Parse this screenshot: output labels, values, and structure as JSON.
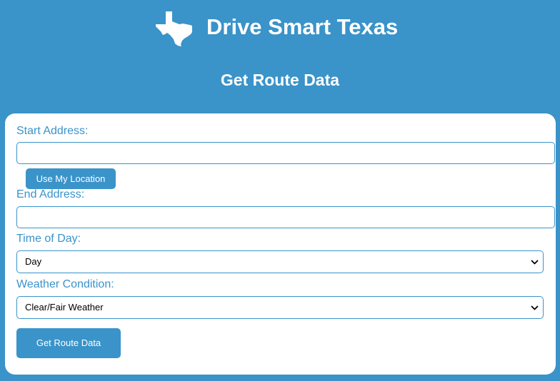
{
  "header": {
    "logo_icon": "texas-state-icon",
    "brand": "Drive Smart Texas",
    "subtitle": "Get Route Data"
  },
  "form": {
    "start_address": {
      "label": "Start Address:",
      "value": "",
      "placeholder": ""
    },
    "use_location_button": "Use My Location",
    "end_address": {
      "label": "End Address:",
      "value": "",
      "placeholder": ""
    },
    "time_of_day": {
      "label": "Time of Day:",
      "selected": "Day"
    },
    "weather_condition": {
      "label": "Weather Condition:",
      "selected": "Clear/Fair Weather"
    },
    "submit_button": "Get Route Data"
  },
  "colors": {
    "primary": "#3a93c9",
    "surface": "#ffffff",
    "text_on_primary": "#ffffff"
  }
}
